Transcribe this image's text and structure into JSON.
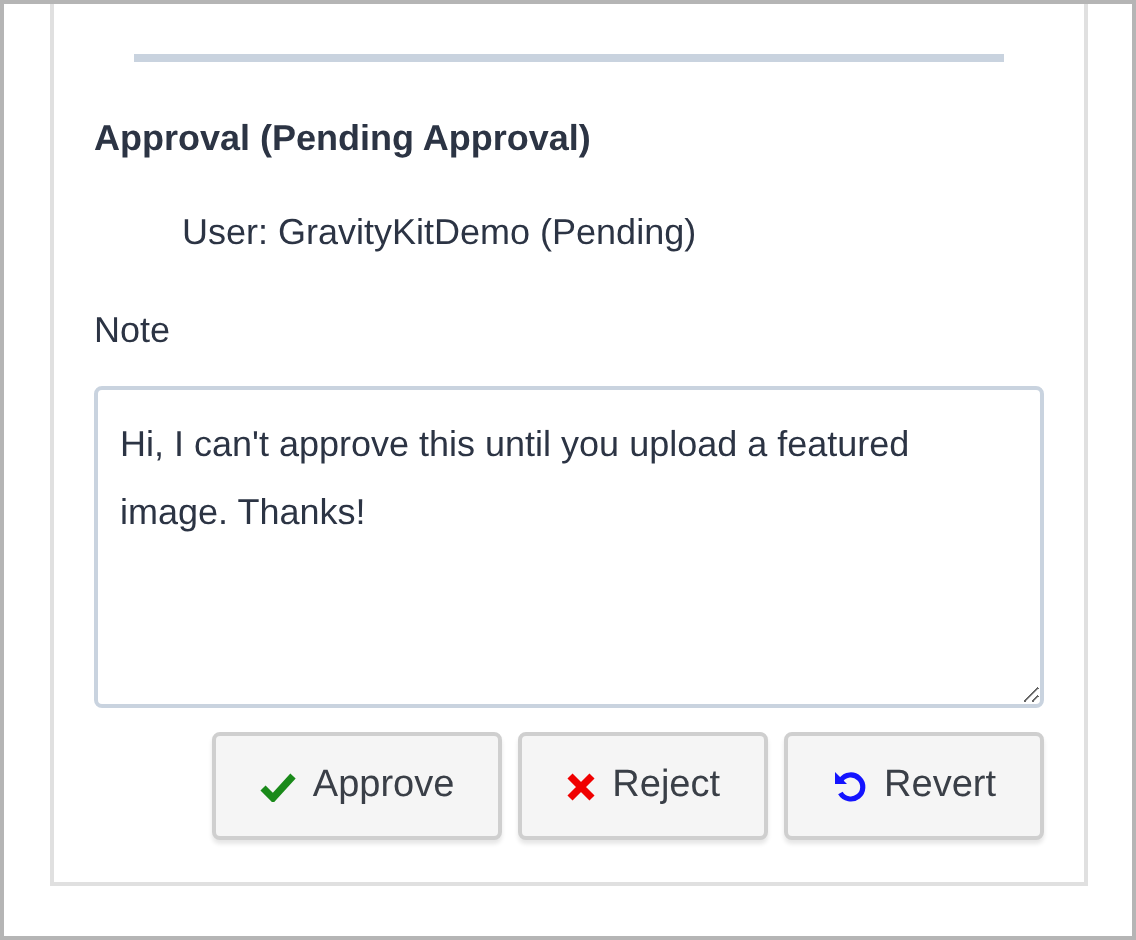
{
  "section": {
    "title": "Approval (Pending Approval)",
    "approvers": [
      {
        "text": "User: GravityKitDemo (Pending)"
      }
    ],
    "note": {
      "label": "Note",
      "value": "Hi, I can't approve this until you upload a featured image. Thanks!"
    },
    "buttons": [
      {
        "kind": "approve",
        "label": "Approve"
      },
      {
        "kind": "reject",
        "label": "Reject"
      },
      {
        "kind": "revert",
        "label": "Revert"
      }
    ]
  }
}
